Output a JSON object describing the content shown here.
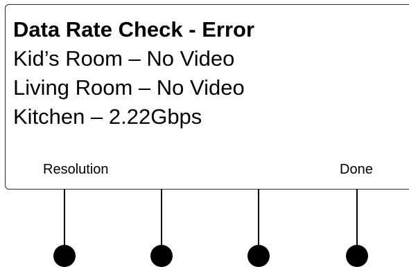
{
  "display": {
    "title": "Data Rate Check - Error",
    "lines": [
      "Kid’s Room – No Video",
      "Living Room – No Video",
      "Kitchen – 2.22Gbps"
    ]
  },
  "softkeys": {
    "key1": "Resolution",
    "key2": "",
    "key3": "",
    "key4": "Done"
  }
}
